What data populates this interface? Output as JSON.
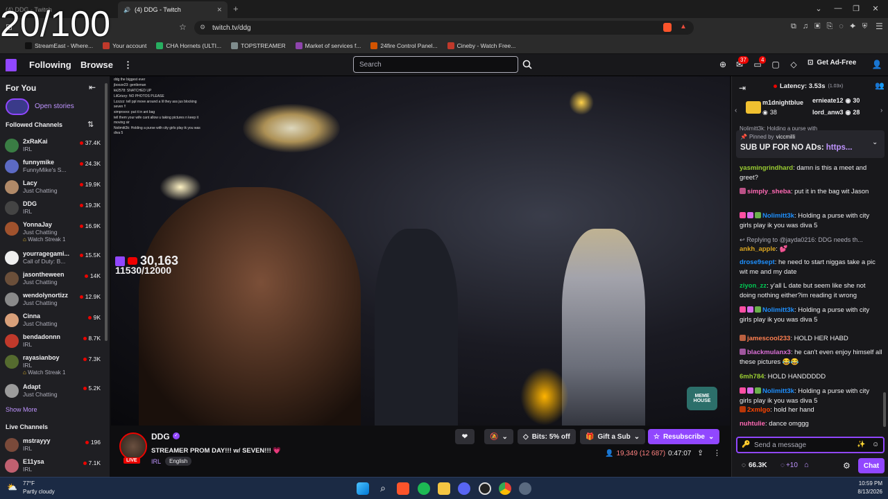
{
  "overlay_counter": "20/100",
  "browser": {
    "tab_inactive": "(4) DDG - Twitch",
    "tab_active": "(4) DDG - Twitch",
    "new_tab": "+",
    "url": "twitch.tv/ddg",
    "bookmarks": [
      {
        "label": "StreamEast - Where...",
        "color": "#111111"
      },
      {
        "label": "Your account",
        "color": "#c0392b"
      },
      {
        "label": "CHA Hornets (ULTI...",
        "color": "#27ae60"
      },
      {
        "label": "TOPSTREAMER",
        "color": "#7f8c8d"
      },
      {
        "label": "Market of services f...",
        "color": "#8e44ad"
      },
      {
        "label": "24fire Control Panel...",
        "color": "#d35400"
      },
      {
        "label": "Cineby - Watch Free...",
        "color": "#c0392b"
      }
    ]
  },
  "twitch": {
    "nav": {
      "following": "Following",
      "browse": "Browse",
      "more": "⋮"
    },
    "search_placeholder": "Search",
    "notifications_count": "37",
    "inbox_count": "4",
    "get_ad_free": "Get Ad-Free"
  },
  "sidebar": {
    "for_you": "For You",
    "open_stories": "Open stories",
    "followed_title": "Followed Channels",
    "show_more": "Show More",
    "live_title": "Live Channels",
    "followed": [
      {
        "name": "2xRaKai",
        "category": "IRL",
        "viewers": "37.4K",
        "color": "#3a7d44",
        "streak": ""
      },
      {
        "name": "funnymike",
        "category": "FunnyMike's S...",
        "viewers": "24.3K",
        "color": "#5c6ac4",
        "streak": ""
      },
      {
        "name": "Lacy",
        "category": "Just Chatting",
        "viewers": "19.9K",
        "color": "#b08968",
        "streak": ""
      },
      {
        "name": "DDG",
        "category": "IRL",
        "viewers": "19.3K",
        "color": "#444444",
        "streak": ""
      },
      {
        "name": "YonnaJay",
        "category": "Just Chatting",
        "viewers": "16.9K",
        "color": "#a0522d",
        "streak": "Watch Streak 1"
      },
      {
        "name": "yourragegami...",
        "category": "Call of Duty: B...",
        "viewers": "15.5K",
        "color": "#eeeeee",
        "streak": ""
      },
      {
        "name": "jasontheween",
        "category": "Just Chatting",
        "viewers": "14K",
        "color": "#6b4f3a",
        "streak": ""
      },
      {
        "name": "wendolynortizz",
        "category": "Just Chatting",
        "viewers": "12.9K",
        "color": "#8a8a8a",
        "streak": ""
      },
      {
        "name": "Cinna",
        "category": "Just Chatting",
        "viewers": "9K",
        "color": "#d9a07a",
        "streak": ""
      },
      {
        "name": "bendadonnn",
        "category": "IRL",
        "viewers": "8.7K",
        "color": "#c0392b",
        "streak": ""
      },
      {
        "name": "rayasianboy",
        "category": "IRL",
        "viewers": "7.3K",
        "color": "#556b2f",
        "streak": "Watch Streak 1"
      },
      {
        "name": "Adapt",
        "category": "Just Chatting",
        "viewers": "5.2K",
        "color": "#9b9b9b",
        "streak": ""
      }
    ],
    "live": [
      {
        "name": "mstrayyy",
        "category": "IRL",
        "viewers": "196",
        "color": "#7a4a3a"
      },
      {
        "name": "E11ysa",
        "category": "IRL",
        "viewers": "7.1K",
        "color": "#c06070"
      }
    ]
  },
  "video": {
    "sub_count": "30,163",
    "sub_goal": "11530/12000",
    "watermark": "MEME HOUSE",
    "mini_chat": [
      "ddg the biggest ever",
      "jbooze23: gentleman",
      "kk2578: SNATCHED UP",
      "LilGrizzy: NO PHOTOS PLEASE",
      "Lzzzzz: tell ppl move around a lil they ass jus blocking seven !!",
      "simprsvxx: put it in ant bag",
      "tell them your wife cant allow u taking pictures n keep it moving sir",
      "Nolimitt3k: Holding a purse with city girls play ik you was diva 5"
    ]
  },
  "stream": {
    "channel": "DDG",
    "title": "STREAMER PROM DAY!!! w/ SEVEN!!! 💗",
    "live": "LIVE",
    "category": "IRL",
    "tag": "English",
    "bits": "Bits: 5% off",
    "gift": "Gift a Sub",
    "resub": "Resubscribe",
    "viewers": "19,349 (12 687)",
    "uptime": "0:47:07"
  },
  "chat": {
    "latency": "Latency: 3.53s",
    "latency_rate": "(1.03x)",
    "leader_1": {
      "name": "m1dnightblue",
      "count": "38"
    },
    "leader_2": {
      "name": "ernieate12",
      "count": "30"
    },
    "leader_3": {
      "name": "lord_anw3",
      "count": "28"
    },
    "pinned_by": "Pinned by",
    "pinned_user": "viccmilli",
    "pinned_text": "SUB UP FOR NO ADs:",
    "pinned_link": "https...",
    "top_partial": "Nolimitt3k: Holding a purse with",
    "messages": [
      {
        "user": "yasmingrindhard",
        "color": "#9acd32",
        "text": "damn is this a meet and greet?"
      },
      {
        "user": "simply_sheba",
        "color": "#ff69b4",
        "text": "put it in the bag wit Jason"
      },
      {
        "user": "Nolimitt3k",
        "color": "#1e90ff",
        "text": "Holding a purse with city girls play ik you was diva 5"
      },
      {
        "user": "",
        "color": "#adadb8",
        "text": "Replying to @jayda0216: DDG needs th..."
      },
      {
        "user": "ankh_apple",
        "color": "#daa520",
        "text": "💕"
      },
      {
        "user": "drose9sept",
        "color": "#1e90ff",
        "text": "he need to start niggas take a pic wit me and my date"
      },
      {
        "user": "ziyon_zz",
        "color": "#00c853",
        "text": "y'all L date but seem like she not doing nothing either?im reading it wrong"
      },
      {
        "user": "Nolimitt3k",
        "color": "#1e90ff",
        "text": "Holding a purse with city girls play ik you was diva 5"
      },
      {
        "user": "jamescool233",
        "color": "#ff7f50",
        "text": "HOLD HER HABD"
      },
      {
        "user": "blackmulanx3",
        "color": "#da70d6",
        "text": "he can't even enjoy himself all these pictures 😂😂"
      },
      {
        "user": "6mh784",
        "color": "#9acd32",
        "text": "HOLD HANDDDDD"
      },
      {
        "user": "Nolimitt3k",
        "color": "#1e90ff",
        "text": "Holding a purse with city girls play ik you was diva 5"
      },
      {
        "user": "2xmlgo",
        "color": "#ff4500",
        "text": "hold her hand"
      },
      {
        "user": "nuhtulie",
        "color": "#ff69b4",
        "text": "dance omggg"
      }
    ],
    "input_placeholder": "Send a message",
    "points": "66.3K",
    "bonus": "+10",
    "chat_button": "Chat"
  },
  "taskbar": {
    "weather_temp": "77°F",
    "weather_desc": "Partly cloudy",
    "time": "10:59 PM",
    "date": "8/13/2026"
  }
}
